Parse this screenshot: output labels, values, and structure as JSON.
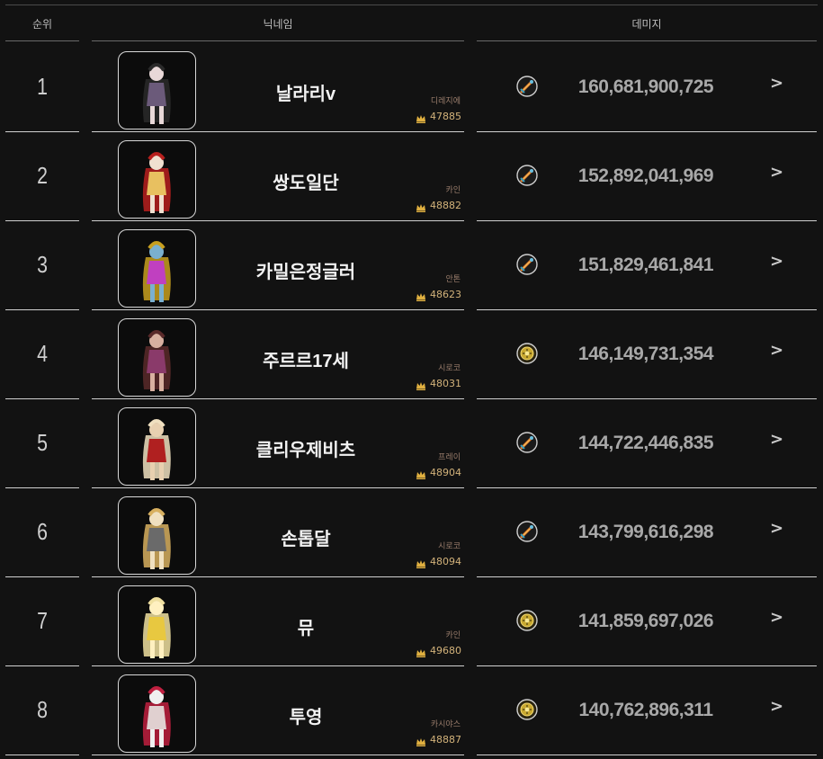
{
  "header": {
    "rank": "순위",
    "nickname": "닉네임",
    "damage": "데미지"
  },
  "rows": [
    {
      "rank": "1",
      "name": "날라리v",
      "server": "디레지에",
      "fame": "47885",
      "damage": "160,681,900,725",
      "class_icon": "sword-icon"
    },
    {
      "rank": "2",
      "name": "쌍도일단",
      "server": "카인",
      "fame": "48882",
      "damage": "152,892,041,969",
      "class_icon": "sword-icon"
    },
    {
      "rank": "3",
      "name": "카밀은정글러",
      "server": "안톤",
      "fame": "48623",
      "damage": "151,829,461,841",
      "class_icon": "sword-icon"
    },
    {
      "rank": "4",
      "name": "주르르17세",
      "server": "시로코",
      "fame": "48031",
      "damage": "146,149,731,354",
      "class_icon": "gold-emblem-icon"
    },
    {
      "rank": "5",
      "name": "클리우제비츠",
      "server": "프레이",
      "fame": "48904",
      "damage": "144,722,446,835",
      "class_icon": "sword-icon"
    },
    {
      "rank": "6",
      "name": "손톱달",
      "server": "시로코",
      "fame": "48094",
      "damage": "143,799,616,298",
      "class_icon": "sword-icon"
    },
    {
      "rank": "7",
      "name": "뮤",
      "server": "카인",
      "fame": "49680",
      "damage": "141,859,697,026",
      "class_icon": "gold-emblem-icon"
    },
    {
      "rank": "8",
      "name": "투영",
      "server": "카시야스",
      "fame": "48887",
      "damage": "140,762,896,311",
      "class_icon": "gold-emblem-icon"
    }
  ],
  "colors": {
    "background": "#121212",
    "fame": "#d2b27a",
    "server": "#9a7d6c",
    "damage": "#a8a8a8"
  }
}
